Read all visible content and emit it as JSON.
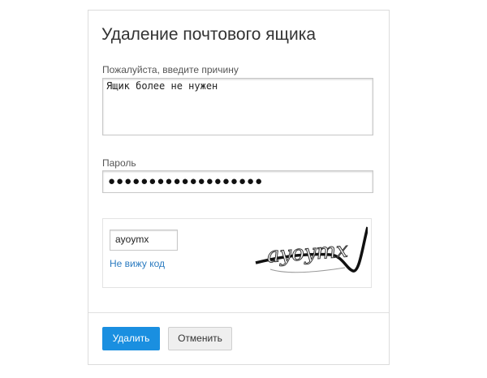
{
  "dialog": {
    "title": "Удаление почтового ящика"
  },
  "reason": {
    "label": "Пожалуйста, введите причину",
    "value": "Ящик более не нужен"
  },
  "password": {
    "label": "Пароль",
    "masked_value": "●●●●●●●●●●●●●●●●●●●"
  },
  "captcha": {
    "input_value": "ayoymx",
    "cant_see_link": "Не вижу код",
    "image_text": "ayoymx"
  },
  "actions": {
    "delete_label": "Удалить",
    "cancel_label": "Отменить",
    "delete_color": "#1a8fe0"
  }
}
